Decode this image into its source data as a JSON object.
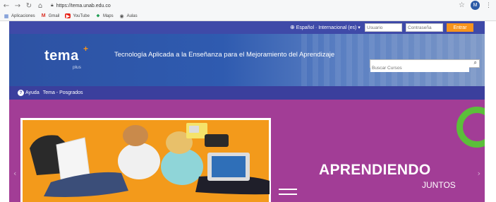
{
  "browser": {
    "url": "https://tema.unab.edu.co",
    "profile_initial": "M",
    "bookmarks": [
      {
        "label": "Aplicaciones",
        "icon": "apps-icon"
      },
      {
        "label": "Gmail",
        "icon": "gmail-icon"
      },
      {
        "label": "YouTube",
        "icon": "youtube-icon"
      },
      {
        "label": "Maps",
        "icon": "maps-icon"
      },
      {
        "label": "Aulas",
        "icon": "aulas-icon"
      }
    ]
  },
  "topbar": {
    "language": "Español · Internacional (es) ▾",
    "username_placeholder": "Usuario",
    "password_placeholder": "Contraseña",
    "login_label": "Entrar"
  },
  "header": {
    "logo_text": "tema",
    "logo_sub": "plus",
    "tagline": "Tecnología Aplicada a la Enseñanza para el Mejoramiento del Aprendizaje",
    "search_placeholder": "Buscar Cursos"
  },
  "nav": {
    "items": [
      {
        "label": "Ayuda"
      },
      {
        "label": "Tema - Posgrados"
      }
    ]
  },
  "banner": {
    "headline": "APRENDIENDO",
    "subline": "JUNTOS"
  },
  "colors": {
    "topbar": "#3f4aa8",
    "header": "#2f5bb0",
    "nav": "#3b3f9d",
    "banner": "#a23d96",
    "accent": "#f7941d",
    "ring": "#5bbf3a",
    "photo_bg": "#f39a1b"
  }
}
